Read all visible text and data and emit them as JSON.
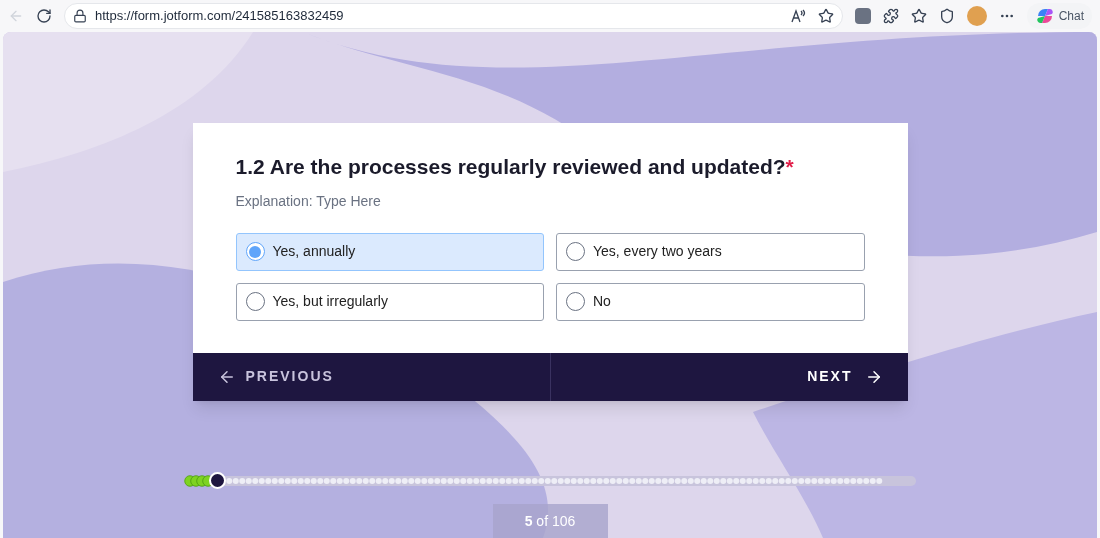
{
  "browser": {
    "url": "https://form.jotform.com/241585163832459",
    "chat_label": "Chat"
  },
  "question": {
    "title": "1.2 Are the processes regularly reviewed and updated?",
    "required_mark": "*",
    "description": "Explanation: Type Here",
    "options": [
      {
        "label": "Yes, annually",
        "selected": true
      },
      {
        "label": "Yes, every two years",
        "selected": false
      },
      {
        "label": "Yes, but irregularly",
        "selected": false
      },
      {
        "label": "No",
        "selected": false
      }
    ]
  },
  "navigation": {
    "previous": "PREVIOUS",
    "next": "NEXT"
  },
  "progress": {
    "level": 0.038,
    "counter": "**5** of 106"
  }
}
